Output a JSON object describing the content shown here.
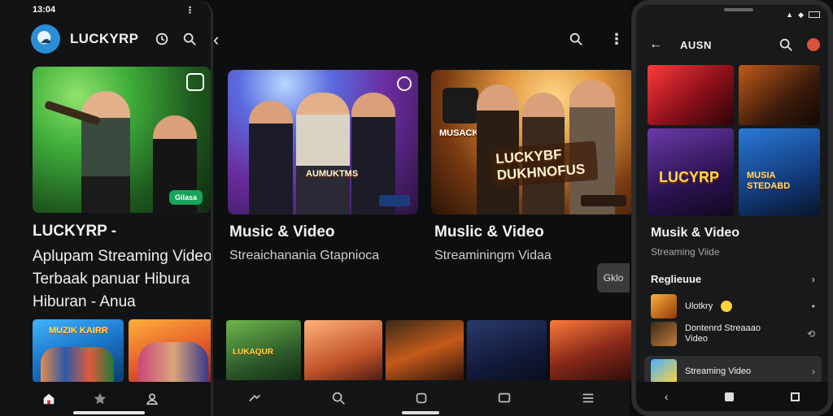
{
  "left_phone": {
    "status_time": "13:04 ",
    "app_title": "LUCKYRP",
    "hero_badge": "Gilasa",
    "title": "LUCKYRP -",
    "description": "Aplupam Streaming Video Terbaak panuar Hibura Hiburan - Anua",
    "thumb1_label": "MUZIK KAIRR",
    "bottom_nav": [
      "home-icon",
      "star-icon",
      "user-icon"
    ]
  },
  "middle": {
    "card1_overlay": "AUMUKTMS",
    "card2_overlay_top": "MUSACK",
    "card2_overlay_main": "LUCKYBF DUKHNOFUS",
    "card1_title": "Music & Video",
    "card1_sub": "Streaichanania Gtapnioca",
    "card2_title": "Muslic & Video",
    "card2_sub": "Streaminingm Vidaa",
    "side_chip": "Gklo",
    "thumb_label": "LUKAQUR"
  },
  "right_phone": {
    "title": "AUSN",
    "tile_a_text": "LUCYRP",
    "tile_b_text": "MUSIA STEDABD",
    "big_title": "Musik & Video",
    "subtitle": "Streaming Viide",
    "section_label": "Reglieuue",
    "rows": [
      {
        "label": "Ulotkry",
        "end": ""
      },
      {
        "label": "Dontenrd Streaaao Video",
        "end": ""
      },
      {
        "label": "Streaming Video",
        "end": "›"
      }
    ]
  },
  "colors": {
    "accent_green": "#19a35a",
    "background": "#0b0c0d"
  }
}
